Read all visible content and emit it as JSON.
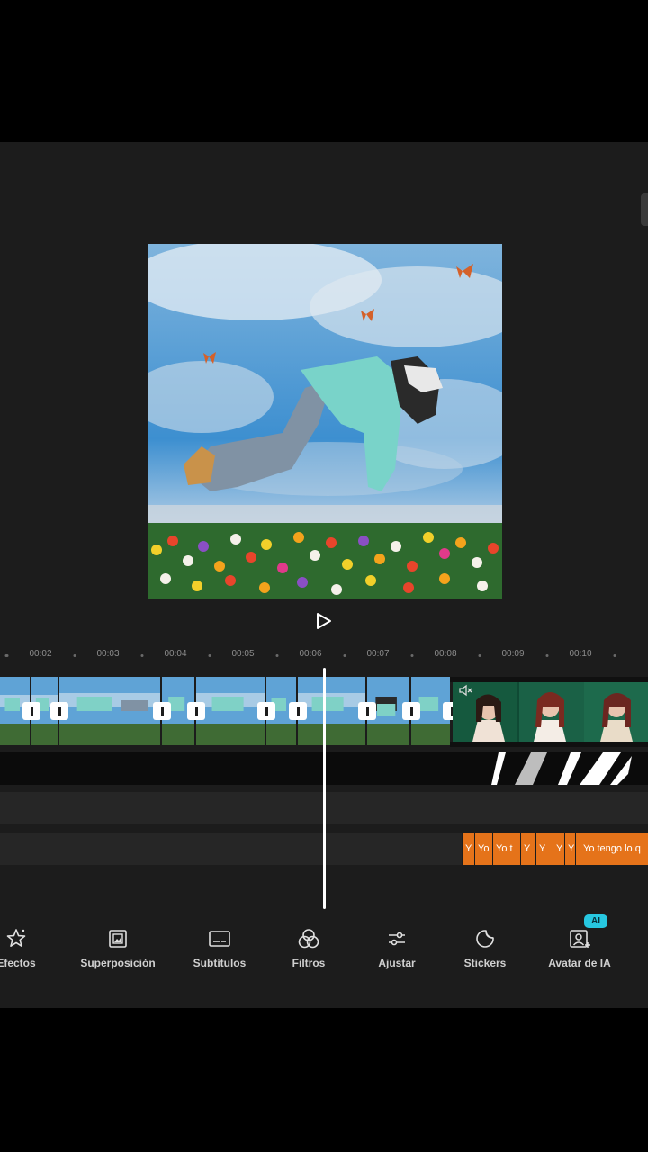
{
  "ruler": {
    "ticks": [
      "00:02",
      "00:03",
      "00:04",
      "00:05",
      "00:06",
      "00:07",
      "00:08",
      "00:09",
      "00:10"
    ]
  },
  "subtitle_clips": [
    {
      "text": "Y"
    },
    {
      "text": "Yo"
    },
    {
      "text": "Yo t"
    },
    {
      "text": "Y"
    },
    {
      "text": "Y"
    },
    {
      "text": "Y"
    },
    {
      "text": "Y"
    },
    {
      "text": "Yo tengo lo q"
    }
  ],
  "toolbar": {
    "items": [
      {
        "label": "Efectos",
        "icon": "effects-star-icon"
      },
      {
        "label": "Superposición",
        "icon": "overlay-image-icon"
      },
      {
        "label": "Subtítulos",
        "icon": "subtitles-icon"
      },
      {
        "label": "Filtros",
        "icon": "filters-circles-icon"
      },
      {
        "label": "Ajustar",
        "icon": "sliders-icon"
      },
      {
        "label": "Stickers",
        "icon": "sticker-icon"
      },
      {
        "label": "Avatar de IA",
        "icon": "ai-avatar-icon"
      }
    ],
    "ai_badge": "AI"
  },
  "colors": {
    "editor_bg": "#1c1c1c",
    "subtitle_clip": "#e5731a",
    "ai_badge": "#27c7e0"
  }
}
